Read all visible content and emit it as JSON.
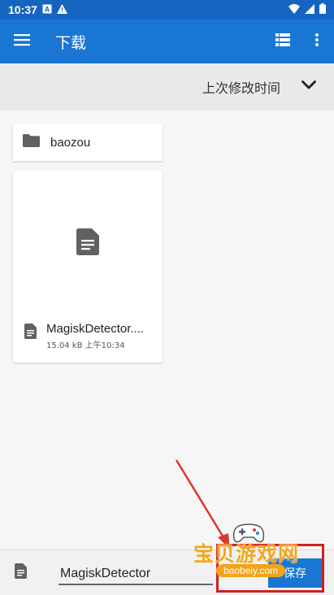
{
  "status_bar": {
    "time": "10:37",
    "icons": [
      "a-notification-icon",
      "warning-icon",
      "wifi-icon",
      "signal-icon",
      "battery-icon"
    ]
  },
  "app_bar": {
    "title": "下载",
    "icons": [
      "menu-icon",
      "list-view-icon",
      "more-vert-icon"
    ]
  },
  "sort_bar": {
    "label": "上次修改时间",
    "icon": "chevron-down-icon"
  },
  "items": {
    "folder": {
      "name": "baozou",
      "icon": "folder-icon"
    },
    "file": {
      "name": "MagiskDetector....",
      "size": "15.04 kB",
      "time": "上午10:34",
      "icon": "document-icon"
    }
  },
  "bottom_bar": {
    "filename_value": "MagiskDetector",
    "save_label": "保存",
    "icon": "document-icon"
  },
  "watermark": {
    "text": "宝贝游戏网",
    "url": "baobeiy.com"
  },
  "colors": {
    "app_bar": "#1976d2",
    "status_bar": "#1565c0",
    "annotation": "#d21f1f",
    "watermark": "#f3a61b"
  }
}
